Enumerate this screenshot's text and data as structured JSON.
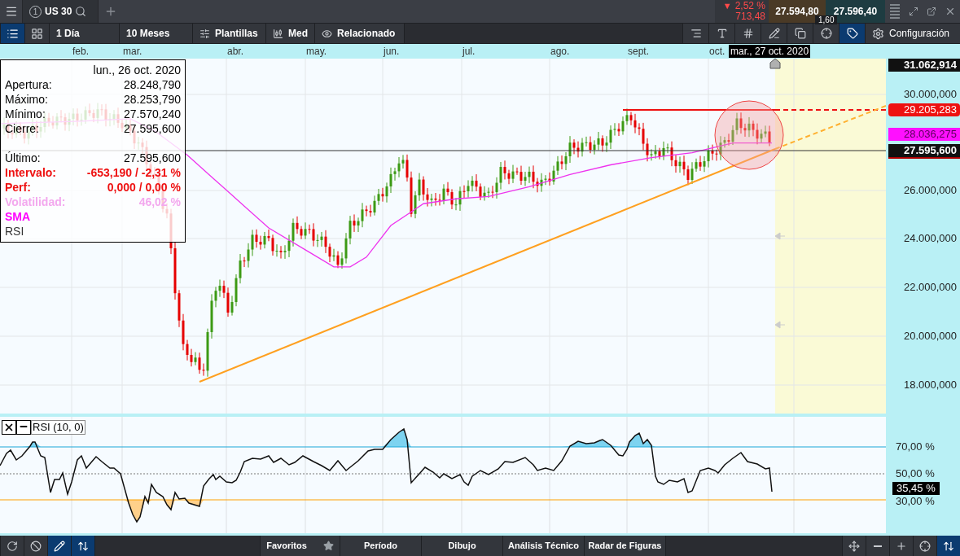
{
  "top_bar": {
    "tab": {
      "number": "1",
      "symbol": "US 30"
    },
    "change": {
      "arrow": "▼",
      "percent": "2,52 %",
      "points": "713,48"
    },
    "sell_price": "27.594,80",
    "buy_price": "27.596,40",
    "spread": "1,60"
  },
  "toolbar": {
    "view_buttons": [
      {
        "selected": true
      },
      {
        "selected": false
      }
    ],
    "period": "1 Día",
    "range": "10 Meses",
    "labeled_buttons": [
      "Plantillas",
      "Med",
      "Relacionado"
    ],
    "tool_buttons": [
      {
        "selected": false
      },
      {
        "selected": false
      },
      {
        "selected": false
      },
      {
        "selected": false
      },
      {
        "selected": false
      },
      {
        "selected": false
      },
      {
        "selected": true
      }
    ],
    "settings": "Configuración"
  },
  "chart": {
    "months": [
      "feb.",
      "mar.",
      "abr.",
      "may.",
      "jun.",
      "jul.",
      "ago.",
      "sept.",
      "oct."
    ],
    "price_labels": [
      {
        "kind": "high",
        "text": "31.062,914"
      },
      {
        "kind": "tick",
        "text": "30.000,000"
      },
      {
        "kind": "level",
        "text": "29.205,283"
      },
      {
        "kind": "sma",
        "text": "28.036,275"
      },
      {
        "kind": "last",
        "text": "27.595,600"
      },
      {
        "kind": "tick",
        "text": "26.000,000"
      },
      {
        "kind": "tick",
        "text": "24.000,000"
      },
      {
        "kind": "tick",
        "text": "22.000,000"
      },
      {
        "kind": "tick",
        "text": "20.000,000"
      },
      {
        "kind": "tick",
        "text": "18.000,000"
      }
    ],
    "date_tooltip": "mar., 27 oct. 2020",
    "info_box": {
      "date": "lun., 26 oct. 2020",
      "ohlc": [
        {
          "label": "Apertura:",
          "value": "28.248,790"
        },
        {
          "label": "Máximo:",
          "value": "28.253,790"
        },
        {
          "label": "Mínimo:",
          "value": "27.570,240"
        },
        {
          "label": "Cierre:",
          "value": "27.595,600"
        }
      ],
      "stats": [
        {
          "label": "Último:",
          "value": "27.595,600",
          "kind": "normal"
        },
        {
          "label": "Intervalo:",
          "value": "-653,190 / -2,31 %",
          "kind": "alert"
        },
        {
          "label": "Perf:",
          "value": "0,000 / 0,00 %",
          "kind": "alert"
        },
        {
          "label": "Volatilidad:",
          "value": "46,02 %",
          "kind": "faded"
        }
      ],
      "indicators": [
        {
          "name": "SMA",
          "color": "#ff00ff"
        },
        {
          "name": "RSI",
          "color": "#333333"
        }
      ]
    }
  },
  "rsi_panel": {
    "title": "RSI (10, 0)",
    "levels": [
      "70,00 %",
      "50,00 %",
      "30,00 %"
    ],
    "current": "35,45 %"
  },
  "bottom_bar": {
    "left_tools": [
      {
        "selected": false
      },
      {
        "selected": false
      },
      {
        "selected": true
      },
      {
        "selected": true
      }
    ],
    "tabs": [
      "Favoritos",
      "Período",
      "Dibujo",
      "Análisis Técnico",
      "Radar de Figuras"
    ],
    "right_tools": [
      {
        "selected": false
      },
      {
        "selected": false
      },
      {
        "selected": false
      },
      {
        "selected": false
      },
      {
        "selected": true
      }
    ]
  }
}
